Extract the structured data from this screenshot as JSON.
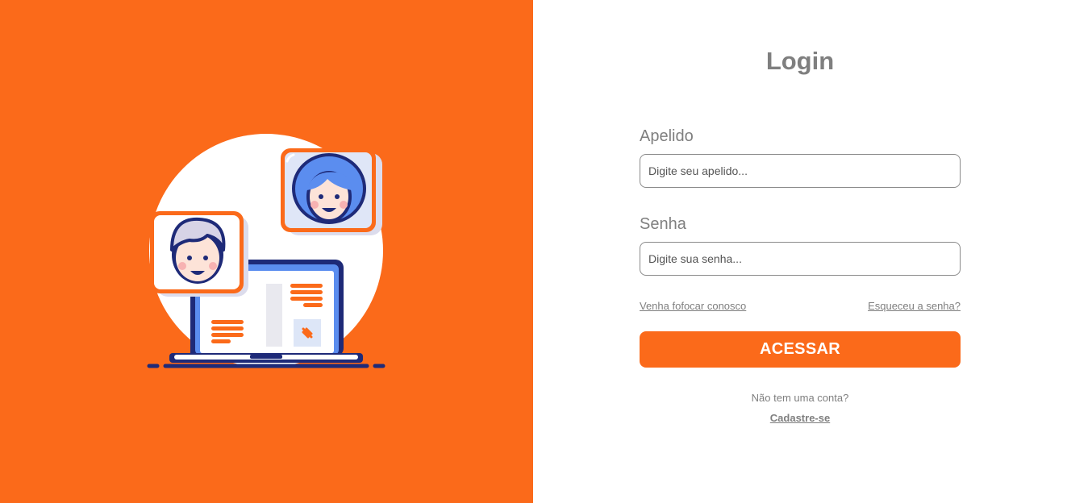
{
  "colors": {
    "brand_orange": "#fb6a1a",
    "text_gray": "#7f7f7f",
    "illustration_navy": "#1e2a78",
    "illustration_blue": "#5b8def"
  },
  "illustration": {
    "icon": "video-chat-laptop-illustration"
  },
  "login": {
    "title": "Login",
    "nickname_label": "Apelido",
    "nickname_placeholder": "Digite seu apelido...",
    "nickname_value": "",
    "password_label": "Senha",
    "password_placeholder": "Digite sua senha...",
    "password_value": "",
    "join_link": "Venha fofocar conosco",
    "forgot_link": "Esqueceu a senha?",
    "submit_label": "ACESSAR",
    "no_account_text": "Não tem uma conta?",
    "signup_link": "Cadastre-se"
  }
}
